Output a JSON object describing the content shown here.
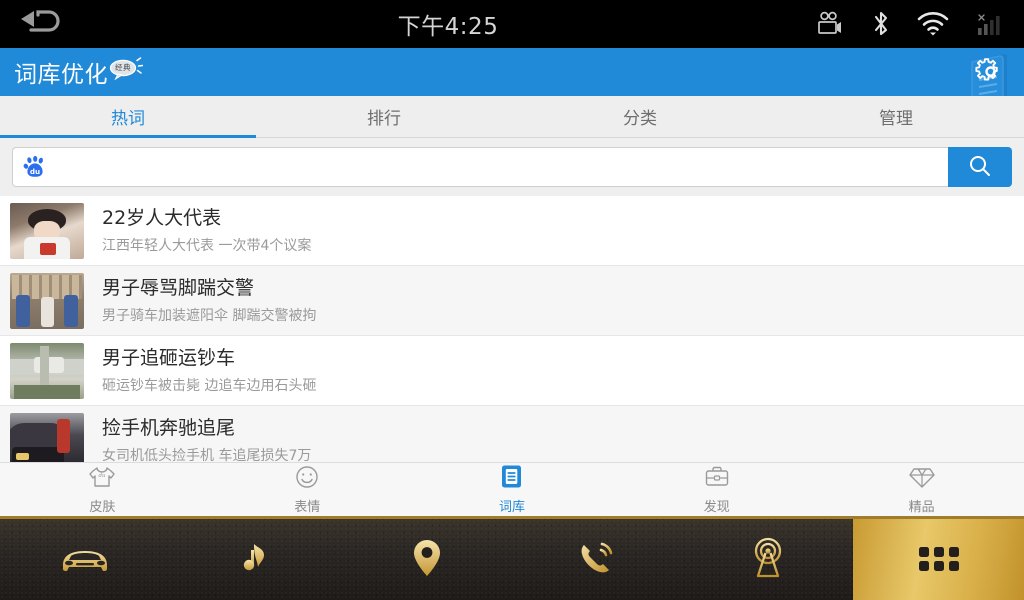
{
  "statusbar": {
    "back_icon": "back-arrow-icon",
    "time": "下午4:25",
    "icons": [
      "camcorder-icon",
      "bluetooth-icon",
      "wifi-icon",
      "signal-bars-icon"
    ]
  },
  "header": {
    "title": "词库优化",
    "badge_text": "经典",
    "settings_icon": "gear-icon",
    "accent_color": "#2089d8"
  },
  "tabs": [
    {
      "label": "热词",
      "active": true
    },
    {
      "label": "排行",
      "active": false
    },
    {
      "label": "分类",
      "active": false
    },
    {
      "label": "管理",
      "active": false
    }
  ],
  "search": {
    "logo_icon": "baidu-paw-icon",
    "value": "",
    "placeholder": "",
    "button_icon": "search-icon"
  },
  "hotwords": [
    {
      "title": "22岁人大代表",
      "subtitle": "江西年轻人大代表 一次带4个议案",
      "thumb": "portrait-young-woman-id-card"
    },
    {
      "title": "男子辱骂脚踹交警",
      "subtitle": "男子骑车加装遮阳伞 脚踹交警被拘",
      "thumb": "three-men-police-station"
    },
    {
      "title": "男子追砸运钞车",
      "subtitle": "砸运钞车被击毙 边追车边用石头砸",
      "thumb": "street-scene-armored-van"
    },
    {
      "title": "捡手机奔驰追尾",
      "subtitle": "女司机低头捡手机 车追尾损失7万",
      "thumb": "black-mercedes-person-red"
    }
  ],
  "bottomnav": [
    {
      "label": "皮肤",
      "icon": "tshirt-icon",
      "active": false
    },
    {
      "label": "表情",
      "icon": "smiley-icon",
      "active": false
    },
    {
      "label": "词库",
      "icon": "dictionary-book-icon",
      "active": true
    },
    {
      "label": "发现",
      "icon": "briefcase-icon",
      "active": false
    },
    {
      "label": "精品",
      "icon": "diamond-icon",
      "active": false
    }
  ],
  "sysbar": {
    "items": [
      {
        "icon": "car-icon",
        "selected": false
      },
      {
        "icon": "music-note-icon",
        "selected": false
      },
      {
        "icon": "location-pin-icon",
        "selected": false
      },
      {
        "icon": "phone-call-icon",
        "selected": false
      },
      {
        "icon": "radio-tower-icon",
        "selected": false
      },
      {
        "icon": "grid-apps-icon",
        "selected": true
      }
    ],
    "gold_color": "#e0bd5c",
    "dark_color": "#221f1c"
  }
}
